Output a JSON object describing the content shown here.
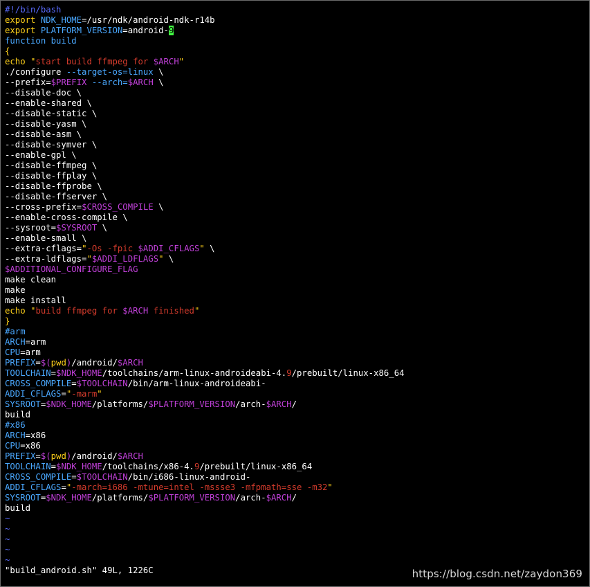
{
  "colors": {
    "background": "#000000",
    "text": "#ffffff",
    "shebang": "#5a6cff",
    "keyword": "#ffd11a",
    "identifier": "#4aa8ff",
    "string": "#d43b2c",
    "variable": "#c040d8",
    "comment": "#4aa8ff",
    "cursor_bg": "#44ff44",
    "tilde": "#5a6cff"
  },
  "editor": {
    "lines": [
      [
        {
          "t": "#!/bin/bash",
          "c": "shebang"
        }
      ],
      [
        {
          "t": "export ",
          "c": "keyword"
        },
        {
          "t": "NDK_HOME",
          "c": "identifier"
        },
        {
          "t": "=/usr/ndk/android-ndk-r14b",
          "c": "text"
        }
      ],
      [
        {
          "t": "export ",
          "c": "keyword"
        },
        {
          "t": "PLATFORM_VERSION",
          "c": "identifier"
        },
        {
          "t": "=android-",
          "c": "text"
        },
        {
          "t": "9",
          "c": "cursor"
        }
      ],
      [
        {
          "t": "function build",
          "c": "identifier"
        }
      ],
      [
        {
          "t": "{",
          "c": "keyword"
        }
      ],
      [
        {
          "t": "echo ",
          "c": "keyword"
        },
        {
          "t": "\"",
          "c": "keyword"
        },
        {
          "t": "start build ffmpeg for ",
          "c": "string"
        },
        {
          "t": "$ARCH",
          "c": "variable"
        },
        {
          "t": "\"",
          "c": "keyword"
        }
      ],
      [
        {
          "t": "./configure ",
          "c": "text"
        },
        {
          "t": "--target-os=linux",
          "c": "identifier"
        },
        {
          "t": " \\",
          "c": "text"
        }
      ],
      [
        {
          "t": "--prefix=",
          "c": "text"
        },
        {
          "t": "$PREFIX",
          "c": "variable"
        },
        {
          "t": " ",
          "c": "text"
        },
        {
          "t": "--arch=",
          "c": "identifier"
        },
        {
          "t": "$ARCH",
          "c": "variable"
        },
        {
          "t": " \\",
          "c": "text"
        }
      ],
      [
        {
          "t": "--disable-doc \\",
          "c": "text"
        }
      ],
      [
        {
          "t": "--enable-shared \\",
          "c": "text"
        }
      ],
      [
        {
          "t": "--disable-static \\",
          "c": "text"
        }
      ],
      [
        {
          "t": "--disable-yasm \\",
          "c": "text"
        }
      ],
      [
        {
          "t": "--disable-asm \\",
          "c": "text"
        }
      ],
      [
        {
          "t": "--disable-symver \\",
          "c": "text"
        }
      ],
      [
        {
          "t": "--enable-gpl \\",
          "c": "text"
        }
      ],
      [
        {
          "t": "--disable-ffmpeg \\",
          "c": "text"
        }
      ],
      [
        {
          "t": "--disable-ffplay \\",
          "c": "text"
        }
      ],
      [
        {
          "t": "--disable-ffprobe \\",
          "c": "text"
        }
      ],
      [
        {
          "t": "--disable-ffserver \\",
          "c": "text"
        }
      ],
      [
        {
          "t": "--cross-prefix=",
          "c": "text"
        },
        {
          "t": "$CROSS_COMPILE",
          "c": "variable"
        },
        {
          "t": " \\",
          "c": "text"
        }
      ],
      [
        {
          "t": "--enable-cross-compile \\",
          "c": "text"
        }
      ],
      [
        {
          "t": "--sysroot=",
          "c": "text"
        },
        {
          "t": "$SYSROOT",
          "c": "variable"
        },
        {
          "t": " \\",
          "c": "text"
        }
      ],
      [
        {
          "t": "--enable-small \\",
          "c": "text"
        }
      ],
      [
        {
          "t": "--extra-cflags=",
          "c": "text"
        },
        {
          "t": "\"",
          "c": "keyword"
        },
        {
          "t": "-Os -fpic ",
          "c": "string"
        },
        {
          "t": "$ADDI_CFLAGS",
          "c": "variable"
        },
        {
          "t": "\"",
          "c": "keyword"
        },
        {
          "t": " \\",
          "c": "text"
        }
      ],
      [
        {
          "t": "--extra-ldflags=",
          "c": "text"
        },
        {
          "t": "\"",
          "c": "keyword"
        },
        {
          "t": "$ADDI_LDFLAGS",
          "c": "variable"
        },
        {
          "t": "\"",
          "c": "keyword"
        },
        {
          "t": " \\",
          "c": "text"
        }
      ],
      [
        {
          "t": "$ADDITIONAL_CONFIGURE_FLAG",
          "c": "variable"
        }
      ],
      [
        {
          "t": "make clean",
          "c": "text"
        }
      ],
      [
        {
          "t": "make",
          "c": "text"
        }
      ],
      [
        {
          "t": "make install",
          "c": "text"
        }
      ],
      [
        {
          "t": "echo ",
          "c": "keyword"
        },
        {
          "t": "\"",
          "c": "keyword"
        },
        {
          "t": "build ffmpeg for ",
          "c": "string"
        },
        {
          "t": "$ARCH",
          "c": "variable"
        },
        {
          "t": " finished",
          "c": "string"
        },
        {
          "t": "\"",
          "c": "keyword"
        }
      ],
      [
        {
          "t": "}",
          "c": "keyword"
        }
      ],
      [
        {
          "t": "#arm",
          "c": "comment"
        }
      ],
      [
        {
          "t": "ARCH",
          "c": "identifier"
        },
        {
          "t": "=arm",
          "c": "text"
        }
      ],
      [
        {
          "t": "CPU",
          "c": "identifier"
        },
        {
          "t": "=arm",
          "c": "text"
        }
      ],
      [
        {
          "t": "PREFIX",
          "c": "identifier"
        },
        {
          "t": "=",
          "c": "text"
        },
        {
          "t": "$(",
          "c": "variable"
        },
        {
          "t": "pwd",
          "c": "keyword"
        },
        {
          "t": ")",
          "c": "variable"
        },
        {
          "t": "/android/",
          "c": "text"
        },
        {
          "t": "$ARCH",
          "c": "variable"
        }
      ],
      [
        {
          "t": "TOOLCHAIN",
          "c": "identifier"
        },
        {
          "t": "=",
          "c": "text"
        },
        {
          "t": "$NDK_HOME",
          "c": "variable"
        },
        {
          "t": "/toolchains/arm-linux-androideabi-4.",
          "c": "text"
        },
        {
          "t": "9",
          "c": "string"
        },
        {
          "t": "/prebuilt/linux-x86_64",
          "c": "text"
        }
      ],
      [
        {
          "t": "CROSS_COMPILE",
          "c": "identifier"
        },
        {
          "t": "=",
          "c": "text"
        },
        {
          "t": "$TOOLCHAIN",
          "c": "variable"
        },
        {
          "t": "/bin/arm-linux-androideabi-",
          "c": "text"
        }
      ],
      [
        {
          "t": "ADDI_CFLAGS",
          "c": "identifier"
        },
        {
          "t": "=",
          "c": "text"
        },
        {
          "t": "\"",
          "c": "keyword"
        },
        {
          "t": "-marm",
          "c": "string"
        },
        {
          "t": "\"",
          "c": "keyword"
        }
      ],
      [
        {
          "t": "SYSROOT",
          "c": "identifier"
        },
        {
          "t": "=",
          "c": "text"
        },
        {
          "t": "$NDK_HOME",
          "c": "variable"
        },
        {
          "t": "/platforms/",
          "c": "text"
        },
        {
          "t": "$PLATFORM_VERSION",
          "c": "variable"
        },
        {
          "t": "/arch-",
          "c": "text"
        },
        {
          "t": "$ARCH",
          "c": "variable"
        },
        {
          "t": "/",
          "c": "text"
        }
      ],
      [
        {
          "t": "build",
          "c": "text"
        }
      ],
      [
        {
          "t": "#x86",
          "c": "comment"
        }
      ],
      [
        {
          "t": "ARCH",
          "c": "identifier"
        },
        {
          "t": "=x86",
          "c": "text"
        }
      ],
      [
        {
          "t": "CPU",
          "c": "identifier"
        },
        {
          "t": "=x86",
          "c": "text"
        }
      ],
      [
        {
          "t": "PREFIX",
          "c": "identifier"
        },
        {
          "t": "=",
          "c": "text"
        },
        {
          "t": "$(",
          "c": "variable"
        },
        {
          "t": "pwd",
          "c": "keyword"
        },
        {
          "t": ")",
          "c": "variable"
        },
        {
          "t": "/android/",
          "c": "text"
        },
        {
          "t": "$ARCH",
          "c": "variable"
        }
      ],
      [
        {
          "t": "TOOLCHAIN",
          "c": "identifier"
        },
        {
          "t": "=",
          "c": "text"
        },
        {
          "t": "$NDK_HOME",
          "c": "variable"
        },
        {
          "t": "/toolchains/x86-4.",
          "c": "text"
        },
        {
          "t": "9",
          "c": "string"
        },
        {
          "t": "/prebuilt/linux-x86_64",
          "c": "text"
        }
      ],
      [
        {
          "t": "CROSS_COMPILE",
          "c": "identifier"
        },
        {
          "t": "=",
          "c": "text"
        },
        {
          "t": "$TOOLCHAIN",
          "c": "variable"
        },
        {
          "t": "/bin/i686-linux-android-",
          "c": "text"
        }
      ],
      [
        {
          "t": "ADDI_CFLAGS",
          "c": "identifier"
        },
        {
          "t": "=",
          "c": "text"
        },
        {
          "t": "\"",
          "c": "keyword"
        },
        {
          "t": "-march=i686 -mtune=intel -mssse3 -mfpmath=sse -m32",
          "c": "string"
        },
        {
          "t": "\"",
          "c": "keyword"
        }
      ],
      [
        {
          "t": "SYSROOT",
          "c": "identifier"
        },
        {
          "t": "=",
          "c": "text"
        },
        {
          "t": "$NDK_HOME",
          "c": "variable"
        },
        {
          "t": "/platforms/",
          "c": "text"
        },
        {
          "t": "$PLATFORM_VERSION",
          "c": "variable"
        },
        {
          "t": "/arch-",
          "c": "text"
        },
        {
          "t": "$ARCH",
          "c": "variable"
        },
        {
          "t": "/",
          "c": "text"
        }
      ],
      [
        {
          "t": "build",
          "c": "text"
        }
      ]
    ],
    "empty_line_marker": "~",
    "empty_line_count": 5
  },
  "status_line": "\"build_android.sh\" 49L, 1226C",
  "watermark": "https://blog.csdn.net/zaydon369"
}
